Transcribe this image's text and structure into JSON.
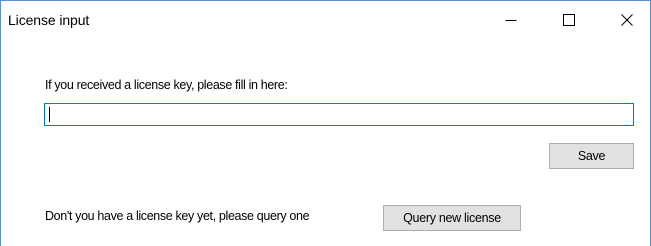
{
  "window": {
    "title": "License input",
    "controls": {
      "minimize_icon": "minimize-icon",
      "maximize_icon": "maximize-icon",
      "close_icon": "close-icon"
    }
  },
  "license_form": {
    "prompt": "If you received a license key, please fill in here:",
    "license_key_value": "",
    "save_label": "Save"
  },
  "query": {
    "prompt": "Don't you have a license key yet, please query one",
    "query_button_label": "Query new license"
  },
  "colors": {
    "window_border": "#5a8fd6",
    "input_focus_border": "#0078d7",
    "button_face": "#e1e1e1",
    "button_border": "#adadad"
  }
}
